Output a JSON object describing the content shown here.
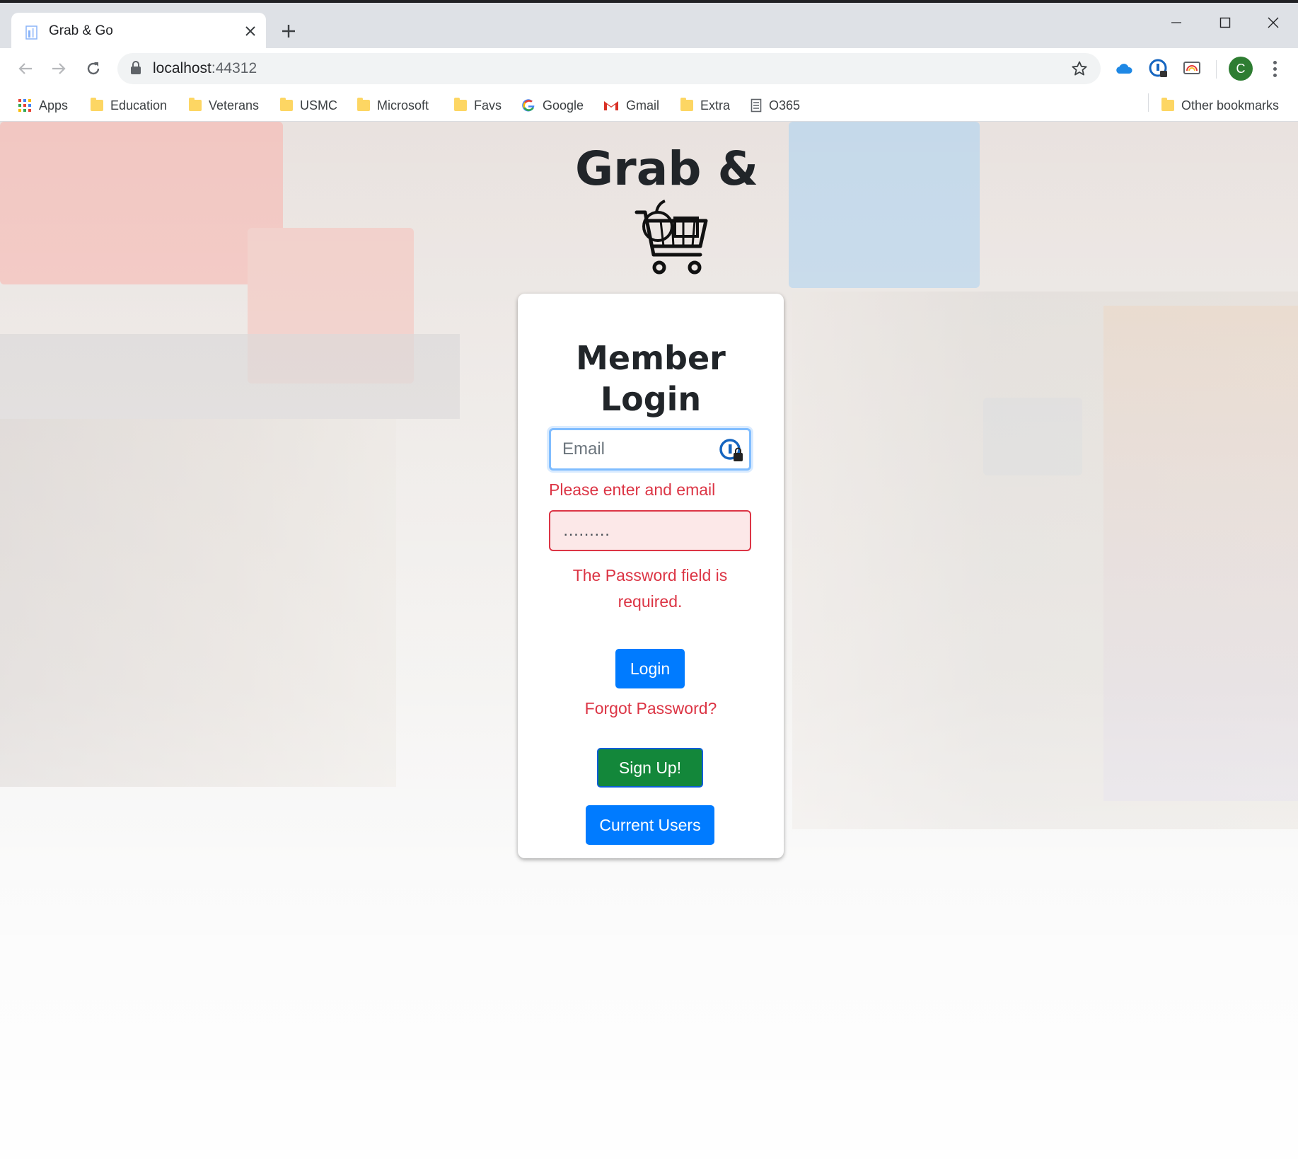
{
  "browser": {
    "tab": {
      "title": "Grab & Go"
    },
    "address": {
      "host": "localhost",
      "port": ":44312"
    },
    "bookmarks": [
      {
        "label": "Apps",
        "icon": "apps-grid-icon"
      },
      {
        "label": "Education",
        "icon": "folder-icon"
      },
      {
        "label": "Veterans",
        "icon": "folder-icon"
      },
      {
        "label": "USMC",
        "icon": "folder-icon"
      },
      {
        "label": "Microsoft",
        "icon": "folder-icon"
      },
      {
        "label": "Favs",
        "icon": "folder-icon"
      },
      {
        "label": "Google",
        "icon": "google-icon"
      },
      {
        "label": "Gmail",
        "icon": "gmail-icon"
      },
      {
        "label": "Extra",
        "icon": "folder-icon"
      },
      {
        "label": "O365",
        "icon": "page-icon"
      }
    ],
    "other_bookmarks": "Other bookmarks",
    "profile_initial": "C"
  },
  "page": {
    "brand": "Grab &",
    "login": {
      "title_line1": "Member",
      "title_line2": "Login",
      "email_placeholder": "Email",
      "email_error": "Please enter and email",
      "password_value": "․․․․․․․․․",
      "password_error": "The Password field is required.",
      "login_button": "Login",
      "forgot_link": "Forgot Password?",
      "signup_button": "Sign Up!",
      "current_users_button": "Current Users"
    }
  },
  "colors": {
    "primary": "#007bff",
    "success": "#13873a",
    "danger": "#dc3545"
  }
}
